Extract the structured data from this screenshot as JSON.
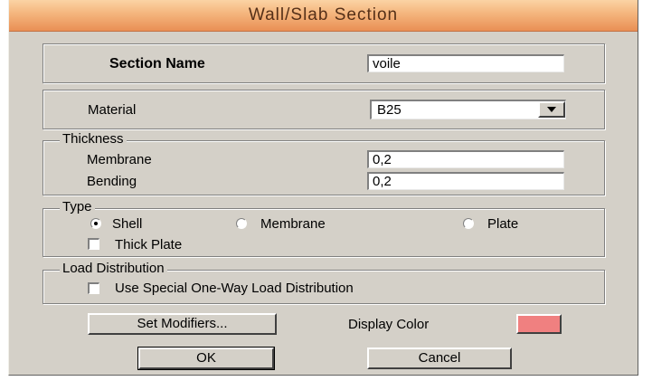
{
  "window": {
    "title": "Wall/Slab Section"
  },
  "section_name": {
    "label": "Section Name",
    "value": "voile"
  },
  "material": {
    "label": "Material",
    "selected": "B25"
  },
  "thickness": {
    "legend": "Thickness",
    "membrane_label": "Membrane",
    "membrane_value": "0,2",
    "bending_label": "Bending",
    "bending_value": "0,2"
  },
  "type": {
    "legend": "Type",
    "options": [
      "Shell",
      "Membrane",
      "Plate"
    ],
    "selected": "Shell",
    "thick_plate_label": "Thick Plate",
    "thick_plate_checked": false
  },
  "load_distribution": {
    "legend": "Load Distribution",
    "one_way_label": "Use Special One-Way Load Distribution",
    "one_way_checked": false
  },
  "buttons": {
    "set_modifiers": "Set Modifiers...",
    "display_color_label": "Display Color",
    "display_color": "#f08080",
    "ok": "OK",
    "cancel": "Cancel"
  }
}
